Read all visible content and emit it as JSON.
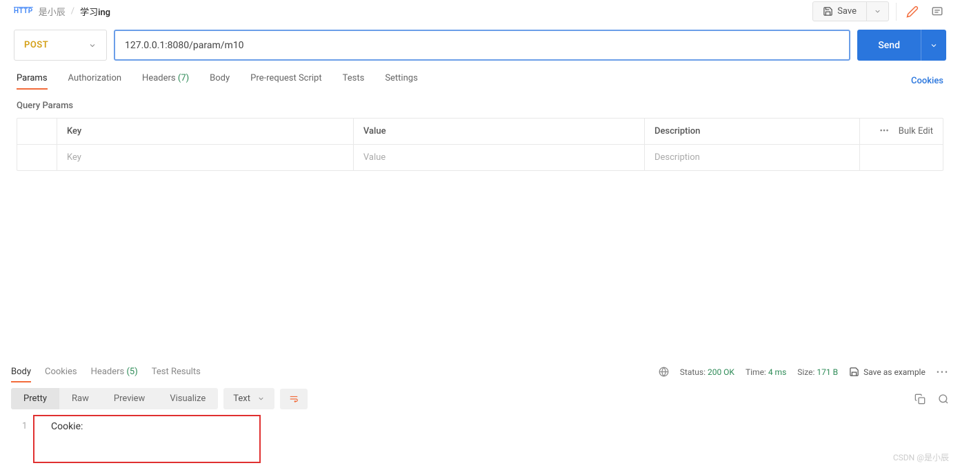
{
  "breadcrumb": {
    "workspace": "是小辰",
    "title": "学习ing"
  },
  "topActions": {
    "save": "Save"
  },
  "request": {
    "method": "POST",
    "url": "127.0.0.1:8080/param/m10",
    "send": "Send"
  },
  "reqTabs": {
    "params": "Params",
    "authorization": "Authorization",
    "headers": "Headers",
    "headersCount": "(7)",
    "body": "Body",
    "preRequest": "Pre-request Script",
    "tests": "Tests",
    "settings": "Settings",
    "cookies": "Cookies"
  },
  "queryParams": {
    "label": "Query Params",
    "headers": {
      "key": "Key",
      "value": "Value",
      "description": "Description",
      "bulkEdit": "Bulk Edit"
    },
    "placeholders": {
      "key": "Key",
      "value": "Value",
      "description": "Description"
    }
  },
  "response": {
    "tabs": {
      "body": "Body",
      "cookies": "Cookies",
      "headers": "Headers",
      "headersCount": "(5)",
      "testResults": "Test Results"
    },
    "meta": {
      "statusLabel": "Status:",
      "statusValue": "200 OK",
      "timeLabel": "Time:",
      "timeValue": "4 ms",
      "sizeLabel": "Size:",
      "sizeValue": "171 B",
      "saveExample": "Save as example"
    },
    "viewTabs": {
      "pretty": "Pretty",
      "raw": "Raw",
      "preview": "Preview",
      "visualize": "Visualize"
    },
    "format": "Text",
    "body": {
      "lineNum": "1",
      "content": "Cookie:"
    }
  },
  "watermark": "CSDN @是小辰"
}
